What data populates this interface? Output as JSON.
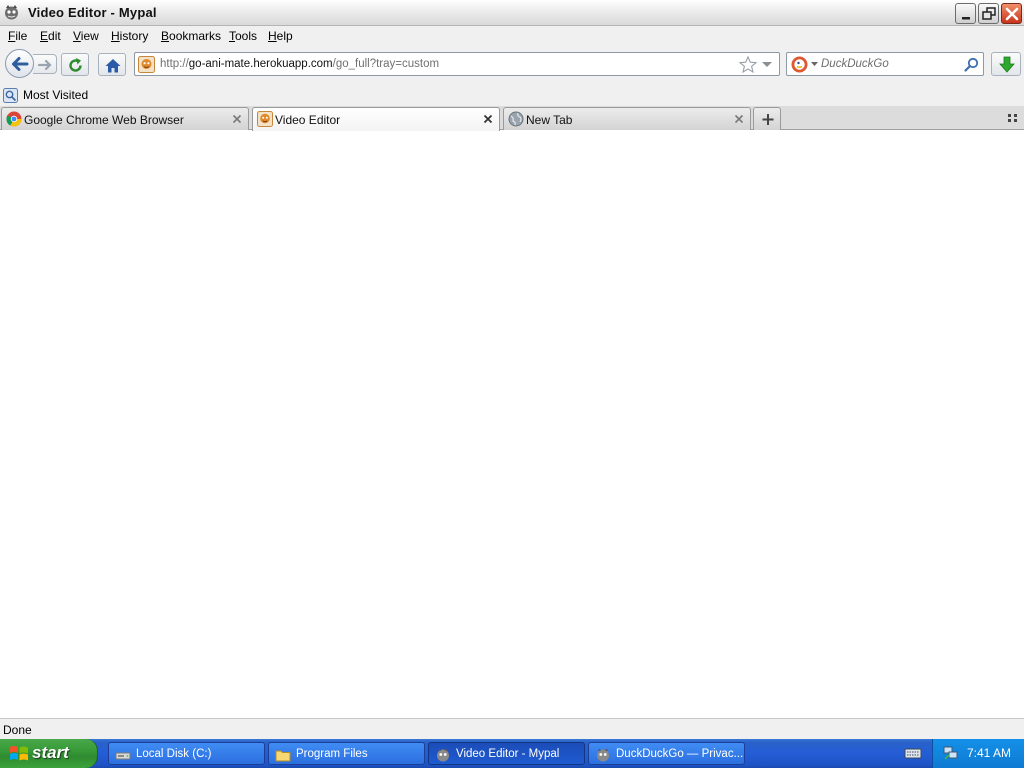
{
  "window": {
    "title": "Video Editor - Mypal"
  },
  "menu": [
    {
      "label": "File",
      "key": "F",
      "rest": "ile"
    },
    {
      "label": "Edit",
      "key": "E",
      "rest": "dit"
    },
    {
      "label": "View",
      "key": "V",
      "rest": "iew"
    },
    {
      "label": "History",
      "key": "H",
      "rest": "istory"
    },
    {
      "label": "Bookmarks",
      "key": "B",
      "rest": "ookmarks"
    },
    {
      "label": "Tools",
      "key": "T",
      "rest": "ools"
    },
    {
      "label": "Help",
      "key": "H",
      "rest": "elp"
    }
  ],
  "urlbar": {
    "scheme": "http://",
    "host": "go-ani-mate.herokuapp.com",
    "path": "/go_full?tray=custom"
  },
  "search": {
    "placeholder": "DuckDuckGo"
  },
  "bookmarks": {
    "items": [
      {
        "label": "Most Visited"
      }
    ]
  },
  "tabs": [
    {
      "label": "Google Chrome Web Browser",
      "active": false,
      "icon": "chrome-icon"
    },
    {
      "label": "Video Editor",
      "active": true,
      "icon": "goanimate-icon"
    },
    {
      "label": "New Tab",
      "active": false,
      "icon": "globe-icon"
    }
  ],
  "status": {
    "text": "Done"
  },
  "taskbar": {
    "start_label": "start",
    "tasks": [
      {
        "label": "Local Disk (C:)",
        "icon": "drive-icon",
        "active": false
      },
      {
        "label": "Program Files",
        "icon": "folder-icon",
        "active": false
      },
      {
        "label": "Video Editor - Mypal",
        "icon": "mypal-icon",
        "active": true
      },
      {
        "label": "DuckDuckGo — Privac...",
        "icon": "mypal-icon",
        "active": false
      }
    ],
    "clock": "7:41 AM"
  },
  "colors": {
    "taskbar_blue": "#245dd6",
    "start_green": "#379a37",
    "close_red": "#c9331b"
  }
}
